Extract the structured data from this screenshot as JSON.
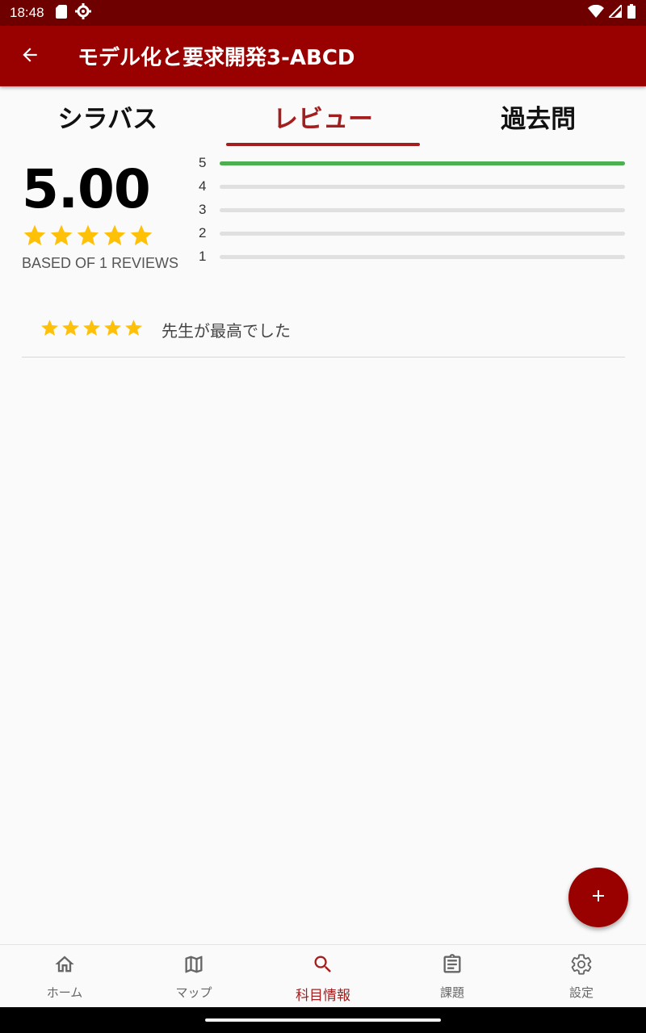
{
  "status_bar": {
    "time": "18:48"
  },
  "app_bar": {
    "title": "モデル化と要求開発3-ABCD"
  },
  "tabs": [
    {
      "label": "シラバス",
      "active": false
    },
    {
      "label": "レビュー",
      "active": true
    },
    {
      "label": "過去問",
      "active": false
    }
  ],
  "summary": {
    "average": "5.00",
    "stars": 5,
    "based_text": "BASED OF 1 REVIEWS"
  },
  "distribution": [
    {
      "label": "5",
      "fraction": 1.0
    },
    {
      "label": "4",
      "fraction": 0
    },
    {
      "label": "3",
      "fraction": 0
    },
    {
      "label": "2",
      "fraction": 0
    },
    {
      "label": "1",
      "fraction": 0
    }
  ],
  "reviews": [
    {
      "stars": 5,
      "text": "先生が最高でした"
    }
  ],
  "bottom_nav": [
    {
      "label": "ホーム",
      "icon": "home-icon",
      "active": false
    },
    {
      "label": "マップ",
      "icon": "map-icon",
      "active": false
    },
    {
      "label": "科目情報",
      "icon": "search-icon",
      "active": true
    },
    {
      "label": "課題",
      "icon": "clipboard-icon",
      "active": false
    },
    {
      "label": "設定",
      "icon": "gear-icon",
      "active": false
    }
  ],
  "colors": {
    "primary": "#990000",
    "status_bar": "#6f0000",
    "accent": "#a31f1f",
    "star": "#ffc107",
    "bar_fill": "#4caf50"
  }
}
